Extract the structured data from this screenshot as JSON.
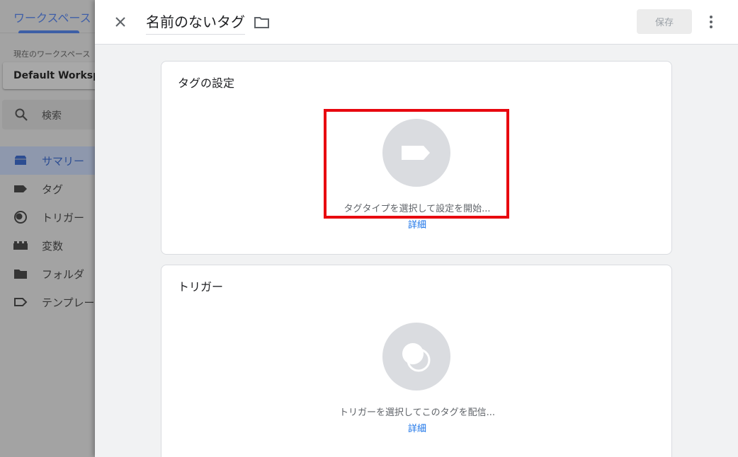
{
  "background": {
    "workspace_tab": "ワークスペース",
    "workspace_label": "現在のワークスペース",
    "workspace_name": "Default Workspace",
    "search_label": "検索",
    "nav": [
      {
        "label": "サマリー",
        "icon": "summary-icon",
        "active": true
      },
      {
        "label": "タグ",
        "icon": "tag-icon",
        "active": false
      },
      {
        "label": "トリガー",
        "icon": "trigger-icon",
        "active": false
      },
      {
        "label": "変数",
        "icon": "variables-icon",
        "active": false
      },
      {
        "label": "フォルダ",
        "icon": "folder-icon",
        "active": false
      },
      {
        "label": "テンプレート",
        "icon": "template-icon",
        "active": false
      }
    ]
  },
  "panel": {
    "title": "名前のないタグ",
    "save_label": "保存",
    "tag_config": {
      "title": "タグの設定",
      "hint": "タグタイプを選択して設定を開始...",
      "link": "詳細"
    },
    "triggering": {
      "title": "トリガー",
      "hint": "トリガーを選択してこのタグを配信...",
      "link": "詳細"
    }
  },
  "colors": {
    "accent": "#1a73e8",
    "highlight": "#e8070f",
    "nav_active": "#2c4d92"
  }
}
